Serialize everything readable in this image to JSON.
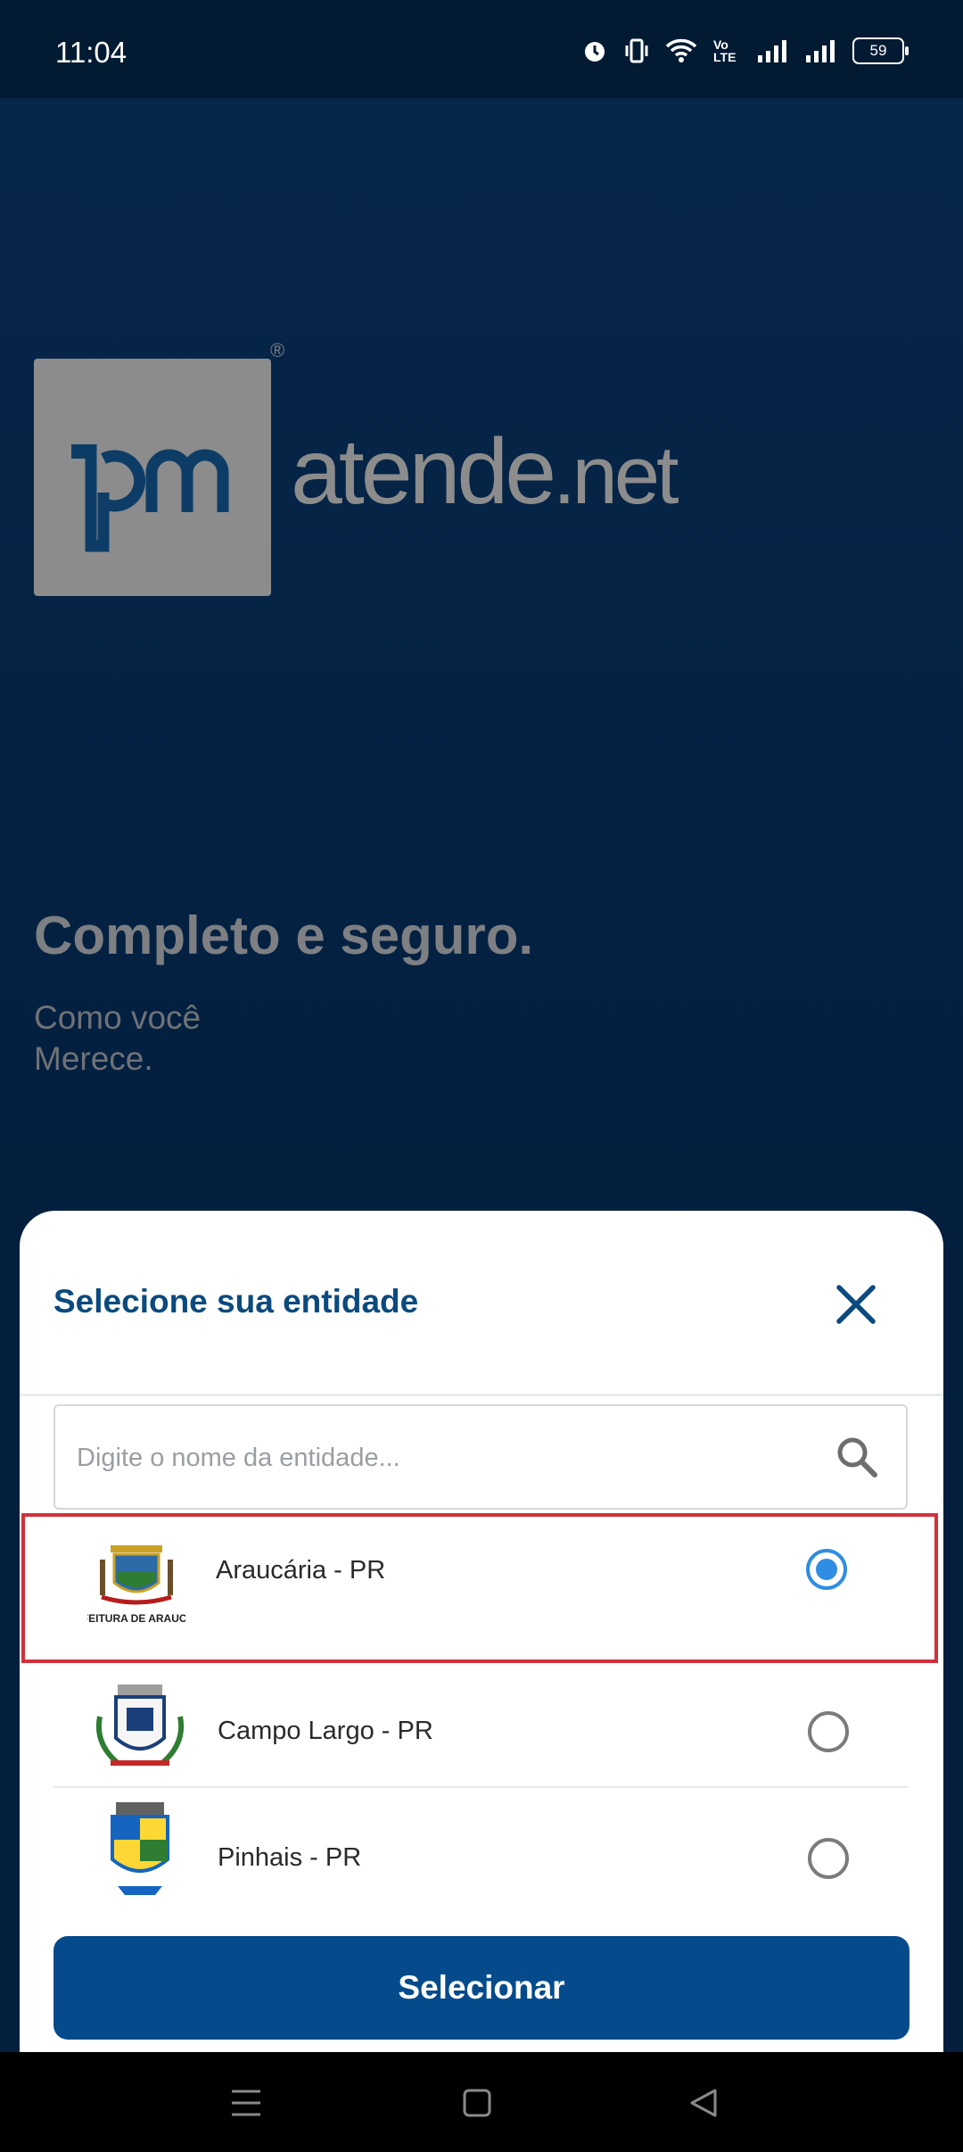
{
  "status": {
    "time": "11:04",
    "battery": "59",
    "volte": "Vo LTE"
  },
  "brand": {
    "name_main": "atende",
    "name_suffix": ".net",
    "logo_text": "ipm",
    "registered": "®"
  },
  "hero": {
    "tagline": "Completo e seguro.",
    "sub_line1": "Como você",
    "sub_line2": "Merece."
  },
  "sheet": {
    "title": "Selecione sua entidade",
    "search_placeholder": "Digite o nome da entidade...",
    "entities": [
      {
        "name": "Araucária - PR",
        "selected": true,
        "crest_caption": "PREFEITURA DE ARAUCÁRIA"
      },
      {
        "name": "Campo Largo - PR",
        "selected": false
      },
      {
        "name": "Pinhais - PR",
        "selected": false
      }
    ],
    "select_label": "Selecionar"
  },
  "colors": {
    "accent": "#054b8c",
    "title": "#0b4a7e",
    "radio": "#2f8de4",
    "highlight": "#d0313c"
  }
}
